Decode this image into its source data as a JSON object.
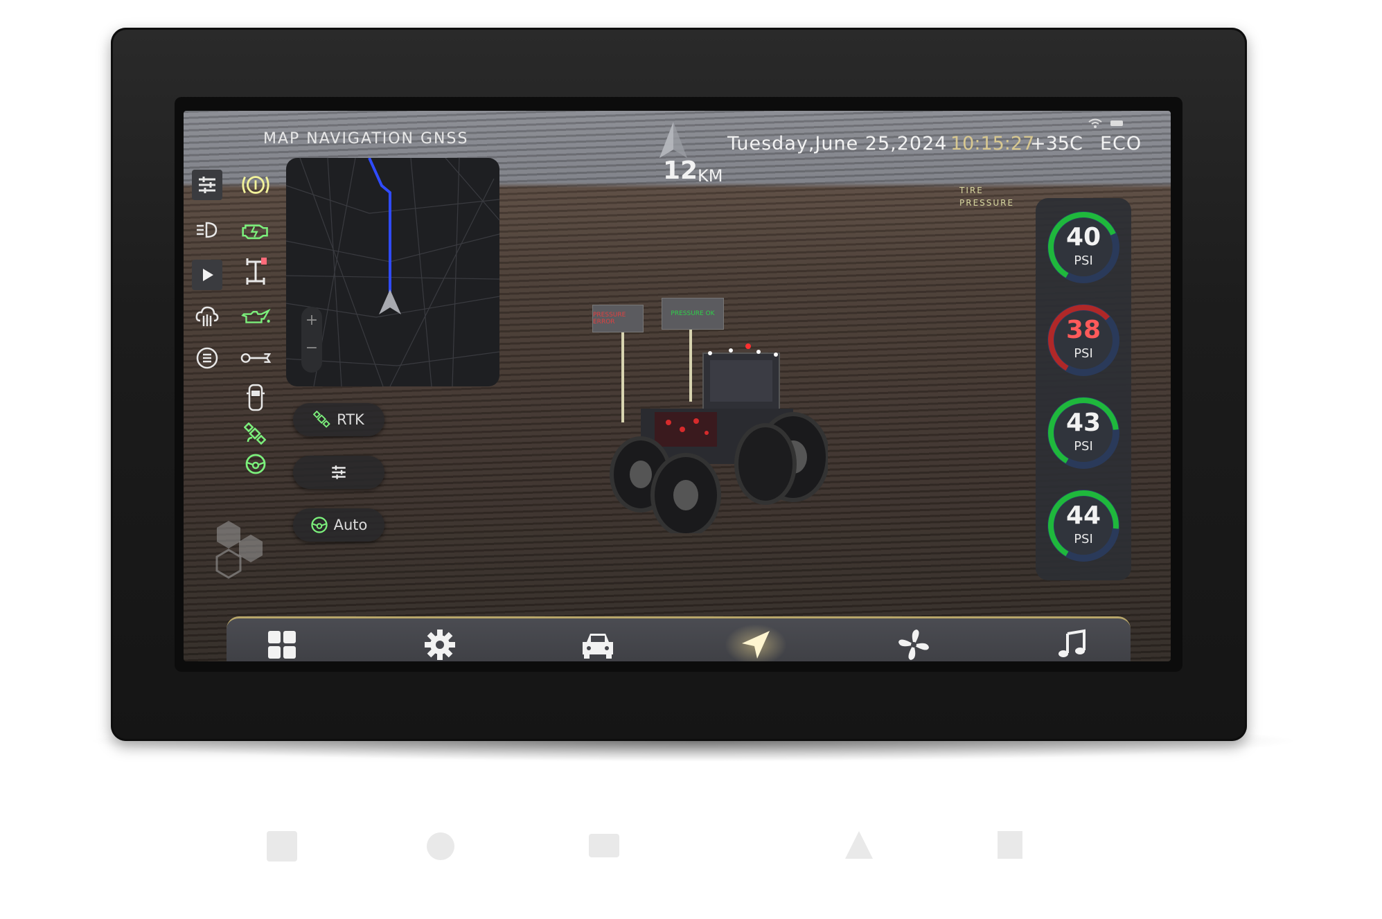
{
  "header": {
    "title": "MAP NAVIGATION GNSS",
    "date": "Tuesday,June 25,2024",
    "time": "10:15:27",
    "temperature": "+35C",
    "mode": "ECO"
  },
  "navigation": {
    "distance_value": "12",
    "distance_unit": "KM",
    "zoom_in": "+",
    "zoom_out": "−"
  },
  "controls": {
    "rtk_label": "RTK",
    "auto_label": "Auto"
  },
  "tire_pressure": {
    "label_line1": "TIRE",
    "label_line2": "PRESSURE",
    "tires": [
      {
        "value": "40",
        "unit": "PSI",
        "status_color": "#1fb83c",
        "fill": 0.6
      },
      {
        "value": "38",
        "unit": "PSI",
        "status_color": "#b02828",
        "fill": 0.55
      },
      {
        "value": "43",
        "unit": "PSI",
        "status_color": "#1fb83c",
        "fill": 0.65
      },
      {
        "value": "44",
        "unit": "PSI",
        "status_color": "#1fb83c",
        "fill": 0.68
      }
    ]
  },
  "scene": {
    "sign_left": "PRESSURE ERROR",
    "sign_right": "PRESSURE OK"
  },
  "colors": {
    "accent": "#b8a66a",
    "warning_green": "#7cf07c",
    "warning_yellow": "#f2f29a",
    "route_blue": "#2f4bff"
  }
}
